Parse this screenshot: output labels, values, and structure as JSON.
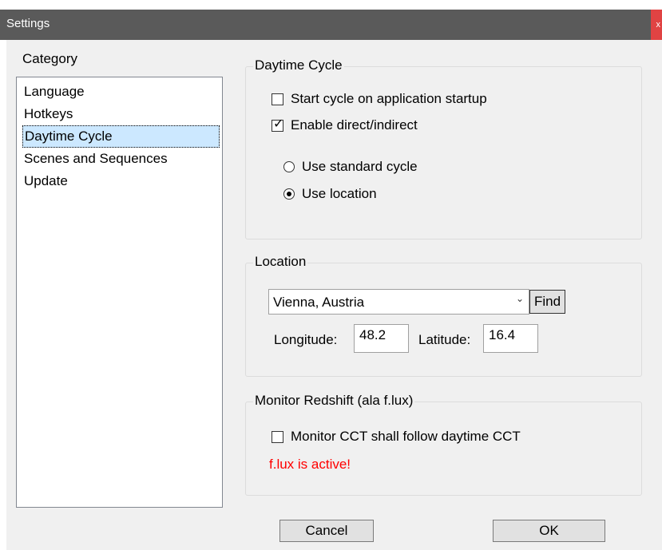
{
  "window": {
    "title": "Settings",
    "close_glyph": "x"
  },
  "category": {
    "label": "Category",
    "items": [
      {
        "label": "Language",
        "selected": false
      },
      {
        "label": "Hotkeys",
        "selected": false
      },
      {
        "label": "Daytime Cycle",
        "selected": true
      },
      {
        "label": "Scenes and Sequences",
        "selected": false
      },
      {
        "label": "Update",
        "selected": false
      }
    ]
  },
  "daytime_cycle": {
    "title": "Daytime Cycle",
    "start_on_startup": {
      "label": "Start cycle on application startup",
      "checked": false
    },
    "enable_direct": {
      "label": "Enable direct/indirect",
      "checked": true
    },
    "use_standard": {
      "label": "Use standard cycle",
      "selected": false
    },
    "use_location": {
      "label": "Use location",
      "selected": true
    }
  },
  "location": {
    "title": "Location",
    "selected_location": "Vienna, Austria",
    "find_label": "Find",
    "longitude_label": "Longitude:",
    "longitude_value": "48.2",
    "latitude_label": "Latitude:",
    "latitude_value": "16.4"
  },
  "monitor": {
    "title": "Monitor Redshift (ala f.lux)",
    "follow_cct": {
      "label": "Monitor CCT shall follow daytime CCT",
      "checked": false
    },
    "warning": "f.lux is active!",
    "warning_color": "#ff0000"
  },
  "buttons": {
    "cancel": "Cancel",
    "ok": "OK"
  },
  "colors": {
    "titlebar": "#5a5a5a",
    "selection": "#cce8ff",
    "close": "#e04343"
  }
}
